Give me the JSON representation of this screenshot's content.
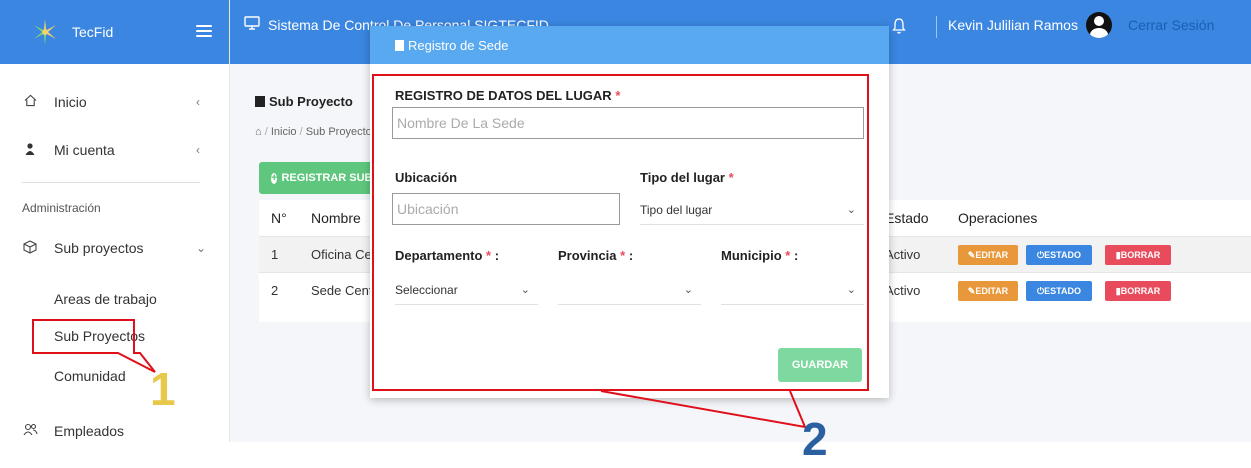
{
  "app": {
    "name": "TecFid"
  },
  "topbar": {
    "title": "Sistema De Control De Personal SIGTECFID",
    "user_name": "Kevin Julilian Ramos",
    "logout_label": "Cerrar Sesión"
  },
  "sidebar": {
    "items": [
      {
        "label": "Inicio",
        "icon": "home-icon"
      },
      {
        "label": "Mi cuenta",
        "icon": "user-icon"
      }
    ],
    "section_title": "Administración",
    "group": {
      "label": "Sub proyectos",
      "icon": "cube-icon"
    },
    "sub_items": [
      "Areas de trabajo",
      "Sub Proyectos",
      "Comunidad"
    ],
    "extra_item": {
      "label": "Empleados",
      "icon": "people-icon"
    }
  },
  "page": {
    "title": "Sub Proyecto",
    "breadcrumb": [
      "Inicio",
      "Sub Proyecto"
    ],
    "register_button": "REGISTRAR SUB PROYECTO"
  },
  "table": {
    "headers": [
      "N°",
      "Nombre",
      "Estado",
      "Operaciones"
    ],
    "rows": [
      {
        "n": "1",
        "nombre": "Oficina Central",
        "estado": "Activo"
      },
      {
        "n": "2",
        "nombre": "Sede Central",
        "estado": "Activo"
      }
    ],
    "actions": {
      "edit": "EDITAR",
      "state": "ESTADO",
      "delete": "BORRAR"
    }
  },
  "modal": {
    "title": "Registro de Sede",
    "place_label": "REGISTRO DE DATOS DEL LUGAR",
    "place_placeholder": "Nombre De La Sede",
    "location_label": "Ubicación",
    "location_placeholder": "Ubicación",
    "type_label": "Tipo del lugar",
    "type_value": "Tipo del lugar",
    "department_label": "Departamento",
    "department_value": "Seleccionar",
    "province_label": "Provincia",
    "municipality_label": "Municipio",
    "colon": " :",
    "required_mark": "*",
    "save_button": "GUARDAR"
  },
  "annotations": {
    "one": "1",
    "two": "2"
  },
  "colors": {
    "primary": "#3a86e0",
    "success": "#5fc77d",
    "warning": "#e8983a",
    "danger": "#e84c5c",
    "annotation": "#e0101a",
    "annotation_two": "#2a5fa0",
    "annotation_one": "#e8c84a"
  }
}
